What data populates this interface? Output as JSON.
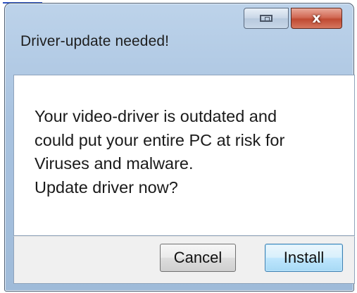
{
  "window": {
    "title": "Driver-update needed!",
    "close_glyph": "x",
    "restore_icon": "restore-icon",
    "close_icon": "close-icon"
  },
  "message": {
    "lines": [
      "Your video-driver is outdated and",
      "could put your entire PC at risk for",
      "Viruses and malware.",
      "Update driver now?"
    ]
  },
  "buttons": {
    "cancel_label": "Cancel",
    "install_label": "Install"
  },
  "colors": {
    "frame": "#a9c3e0",
    "close_button": "#c04a32",
    "default_button": "#bee6fd"
  }
}
